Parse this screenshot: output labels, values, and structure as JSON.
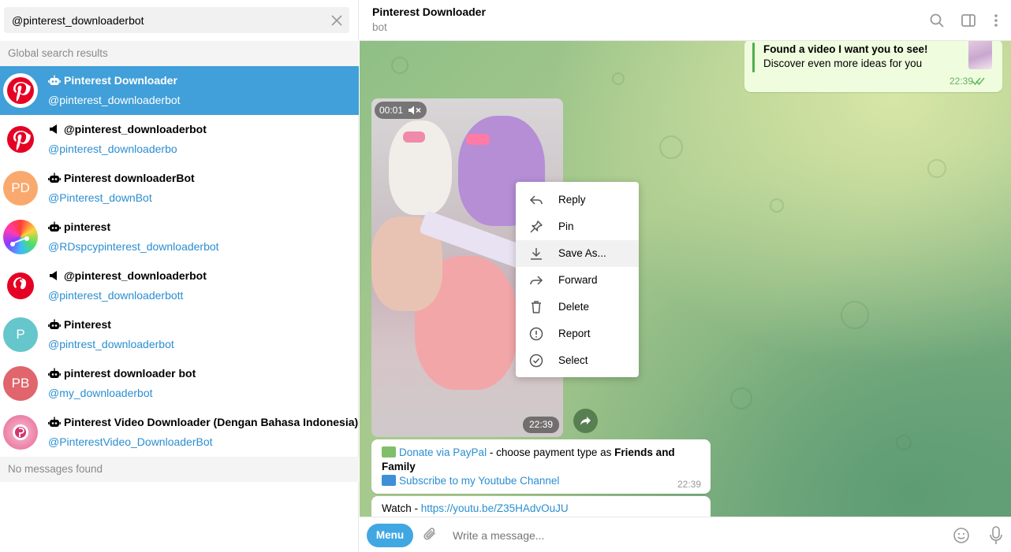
{
  "search": {
    "value": "@pinterest_downloaderbot",
    "clear_icon": "close-icon"
  },
  "sidebar": {
    "global_header": "Global search results",
    "no_messages": "No messages found",
    "results": [
      {
        "title": "Pinterest Downloader",
        "username": "@pinterest_downloaderbot",
        "type": "bot",
        "avatar": "pinterest-logo",
        "active": true
      },
      {
        "title": "@pinterest_downloaderbot",
        "username": "@pinterest_downloaderbo",
        "type": "channel",
        "avatar": "pinterest-logo"
      },
      {
        "title": "Pinterest downloaderBot",
        "username": "@Pinterest_downBot",
        "type": "bot",
        "avatar_initials": "PD",
        "avatar_color": "#f9a96e"
      },
      {
        "title": "pinterest",
        "username": "@RDspcypinterest_downloaderbot",
        "type": "bot",
        "avatar": "rainbow-music"
      },
      {
        "title": "@pinterest_downloaderbot",
        "username": "@pinterest_downloaderbott",
        "type": "channel",
        "avatar": "pinterest-logo"
      },
      {
        "title": "Pinterest",
        "username": "@pintrest_downloaderbot",
        "type": "bot",
        "avatar_initials": "P",
        "avatar_color": "#65c6cb"
      },
      {
        "title": "pinterest downloader bot",
        "username": "@my_downloaderbot",
        "type": "bot",
        "avatar_initials": "PB",
        "avatar_color": "#e0656c"
      },
      {
        "title": "Pinterest Video Downloader (Dengan Bahasa Indonesia)",
        "username": "@PinterestVideo_DownloaderBot",
        "type": "bot",
        "avatar": "pink-pinterest"
      }
    ]
  },
  "chat": {
    "title": "Pinterest Downloader",
    "status": "bot",
    "preview": {
      "title": "Found a video I want you to see!",
      "desc": "Discover even more ideas for you",
      "time": "22:39"
    },
    "video": {
      "duration": "00:01",
      "time": "22:39"
    },
    "donate": {
      "link1": "Donate via PayPal",
      "text1": " - choose payment type as ",
      "bold1": "Friends and Family",
      "link2": "Subscribe to my Youtube Channel",
      "time": "22:39"
    },
    "watch": {
      "prefix": "Watch - ",
      "link": "https://youtu.be/Z35HAdvOuJU"
    }
  },
  "context_menu": {
    "items": [
      {
        "label": "Reply",
        "icon": "reply-icon"
      },
      {
        "label": "Pin",
        "icon": "pin-icon"
      },
      {
        "label": "Save As...",
        "icon": "download-icon",
        "hover": true
      },
      {
        "label": "Forward",
        "icon": "forward-icon"
      },
      {
        "label": "Delete",
        "icon": "trash-icon"
      },
      {
        "label": "Report",
        "icon": "report-icon"
      },
      {
        "label": "Select",
        "icon": "check-circle-icon"
      }
    ]
  },
  "composer": {
    "menu_label": "Menu",
    "placeholder": "Write a message..."
  },
  "colors": {
    "accent": "#419fd9",
    "menu_button": "#40a7e3",
    "link": "#2a8ed1",
    "outgoing_bubble": "#effdde"
  }
}
